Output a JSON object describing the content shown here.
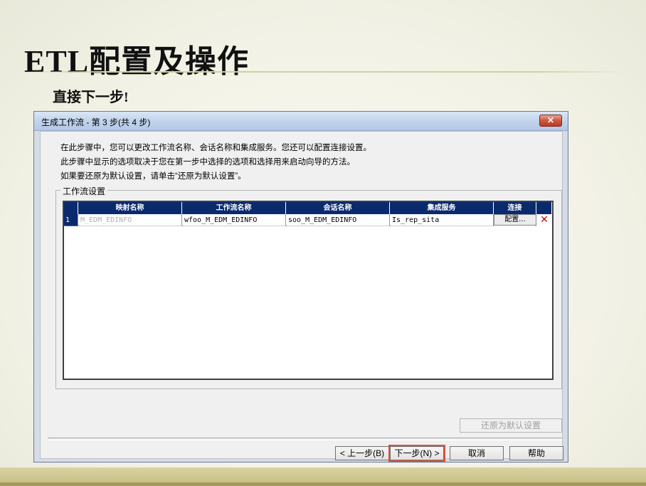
{
  "slide": {
    "title": "ETL配置及操作",
    "subtitle": "直接下一步!"
  },
  "dialog": {
    "title": "生成工作流 - 第 3 步(共 4 步)",
    "close_icon": "close-x-icon",
    "instructions": [
      "在此步骤中，您可以更改工作流名称、会话名称和集成服务。您还可以配置连接设置。",
      "此步骤中显示的选项取决于您在第一步中选择的选项和选择用来启动向导的方法。",
      "如果要还原为默认设置，请单击“还原为默认设置”。"
    ],
    "group_label": "工作流设置",
    "grid": {
      "columns": [
        "映射名称",
        "工作流名称",
        "会话名称",
        "集成服务",
        "连接"
      ],
      "rows": [
        {
          "num": "1",
          "mapping": "M_EDM_EDINFO",
          "workflow": "wfoo_M_EDM_EDINFO",
          "session": "soo_M_EDM_EDINFO",
          "service": "Is_rep_sita",
          "config_label": "配置...",
          "delete_icon": "✕"
        }
      ]
    },
    "restore_label": "还原为默认设置",
    "buttons": {
      "back": "< 上一步(B)",
      "next": "下一步(N) >",
      "cancel": "取消",
      "help": "帮助"
    }
  },
  "colors": {
    "grid_header": "#0a2a6e",
    "delete": "#cc0000",
    "highlight": "#e05040"
  }
}
